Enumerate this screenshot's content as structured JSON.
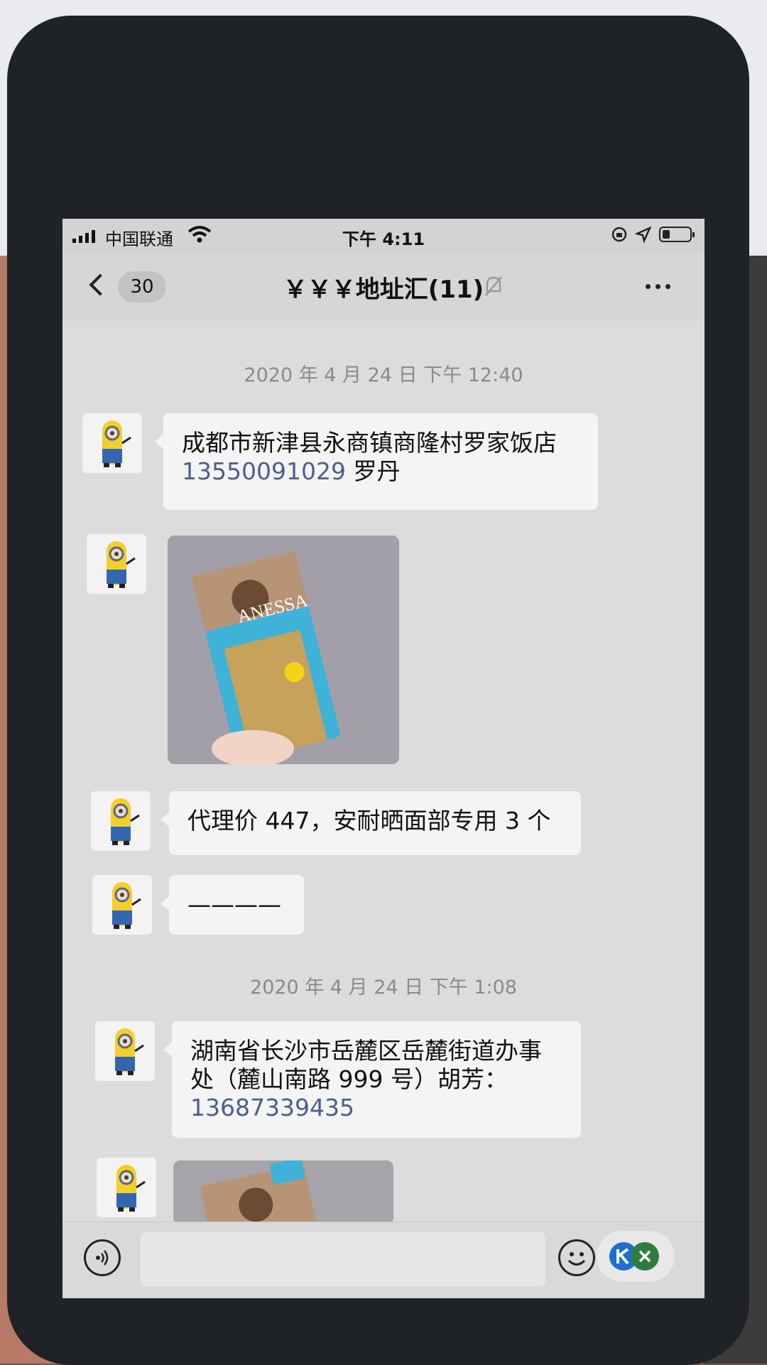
{
  "status_bar": {
    "carrier": "中国联通",
    "time": "下午 4:11"
  },
  "header": {
    "unread_count": "30",
    "title": "￥￥￥地址汇(11)"
  },
  "messages": [
    {
      "type": "timestamp",
      "text": "2020 年 4 月 24 日 下午 12:40"
    },
    {
      "type": "text",
      "text": "成都市新津县永商镇商隆村罗家饭店",
      "phone": "13550091029",
      "suffix": " 罗丹"
    },
    {
      "type": "image",
      "caption": "ANESSA"
    },
    {
      "type": "text",
      "text": "代理价 447，安耐晒面部专用 3 个"
    },
    {
      "type": "text",
      "text": "————"
    },
    {
      "type": "timestamp",
      "text": "2020 年 4 月 24 日 下午 1:08"
    },
    {
      "type": "text",
      "text": "湖南省长沙市岳麓区岳麓街道办事处（麓山南路 999 号）胡芳：",
      "phone": "13687339435"
    },
    {
      "type": "image",
      "caption": ""
    }
  ],
  "colors": {
    "bubble": "#f4f4f4",
    "chat_bg": "#dcdcdc",
    "link": "#4a5f8f"
  }
}
